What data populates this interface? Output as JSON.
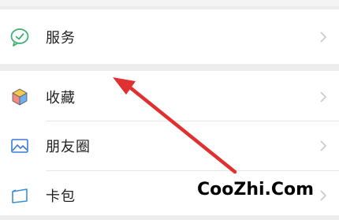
{
  "menu": {
    "service": {
      "label": "服务",
      "icon": "service-check-icon"
    },
    "favorites": {
      "label": "收藏",
      "icon": "favorites-cube-icon"
    },
    "moments": {
      "label": "朋友圈",
      "icon": "moments-picture-icon"
    },
    "cards": {
      "label": "卡包",
      "icon": "card-wallet-icon"
    }
  },
  "watermark": "CooZhi.Com",
  "colors": {
    "service_icon": "#3cb371",
    "arrow": "#e03030",
    "chevron": "#c8c8c8",
    "divider": "#e6e6e6",
    "section_gap": "#ededed"
  }
}
